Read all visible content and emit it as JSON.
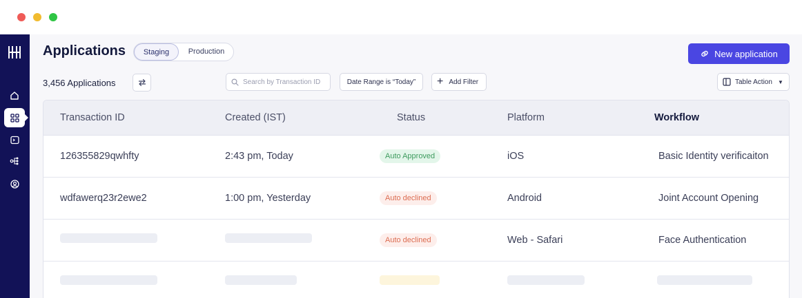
{
  "window": {
    "controls": [
      "close",
      "minimize",
      "maximize"
    ]
  },
  "sidebar": {
    "logo": "hyperverge-logo-icon",
    "items": [
      {
        "icon": "home-icon",
        "active": false
      },
      {
        "icon": "grid-icon",
        "active": true
      },
      {
        "icon": "terminal-icon",
        "active": false
      },
      {
        "icon": "workflow-icon",
        "active": false
      },
      {
        "icon": "user-circle-icon",
        "active": false
      }
    ],
    "background": "#121257"
  },
  "header": {
    "title": "Applications",
    "environments": {
      "options": [
        "Staging",
        "Production"
      ],
      "selected": "Staging"
    },
    "new_button": {
      "label": "New application",
      "icon": "link-icon",
      "color": "#4a46e2"
    }
  },
  "toolbar": {
    "count": "3,456 Applications",
    "sync_icon": "swap-arrows-icon",
    "search_placeholder": "Search by Transaction ID",
    "date_filter": "Date Range is “Today”",
    "add_filter": "Add Filter",
    "table_action": "Table Action"
  },
  "table": {
    "columns": [
      "Transaction ID",
      "Created (IST)",
      "Status",
      "Platform",
      "Workflow"
    ],
    "rows": [
      {
        "transaction_id": "126355829qwhfty",
        "created": "2:43 pm, Today",
        "status": "Auto Approved",
        "platform": "iOS",
        "workflow": "Basic Identity verificaiton"
      },
      {
        "transaction_id": "wdfawerq23r2ewe2",
        "created": "1:00 pm, Yesterday",
        "status": "Auto declined",
        "platform": "Android",
        "workflow": "Joint Account Opening"
      },
      {
        "transaction_id": "",
        "created": "",
        "status": "Auto declined",
        "platform": "Web - Safari",
        "workflow": "Face Authentication"
      }
    ]
  },
  "colors": {
    "approved": "#3e9b5e",
    "declined": "#dc6d52",
    "accent": "#4a46e2"
  }
}
